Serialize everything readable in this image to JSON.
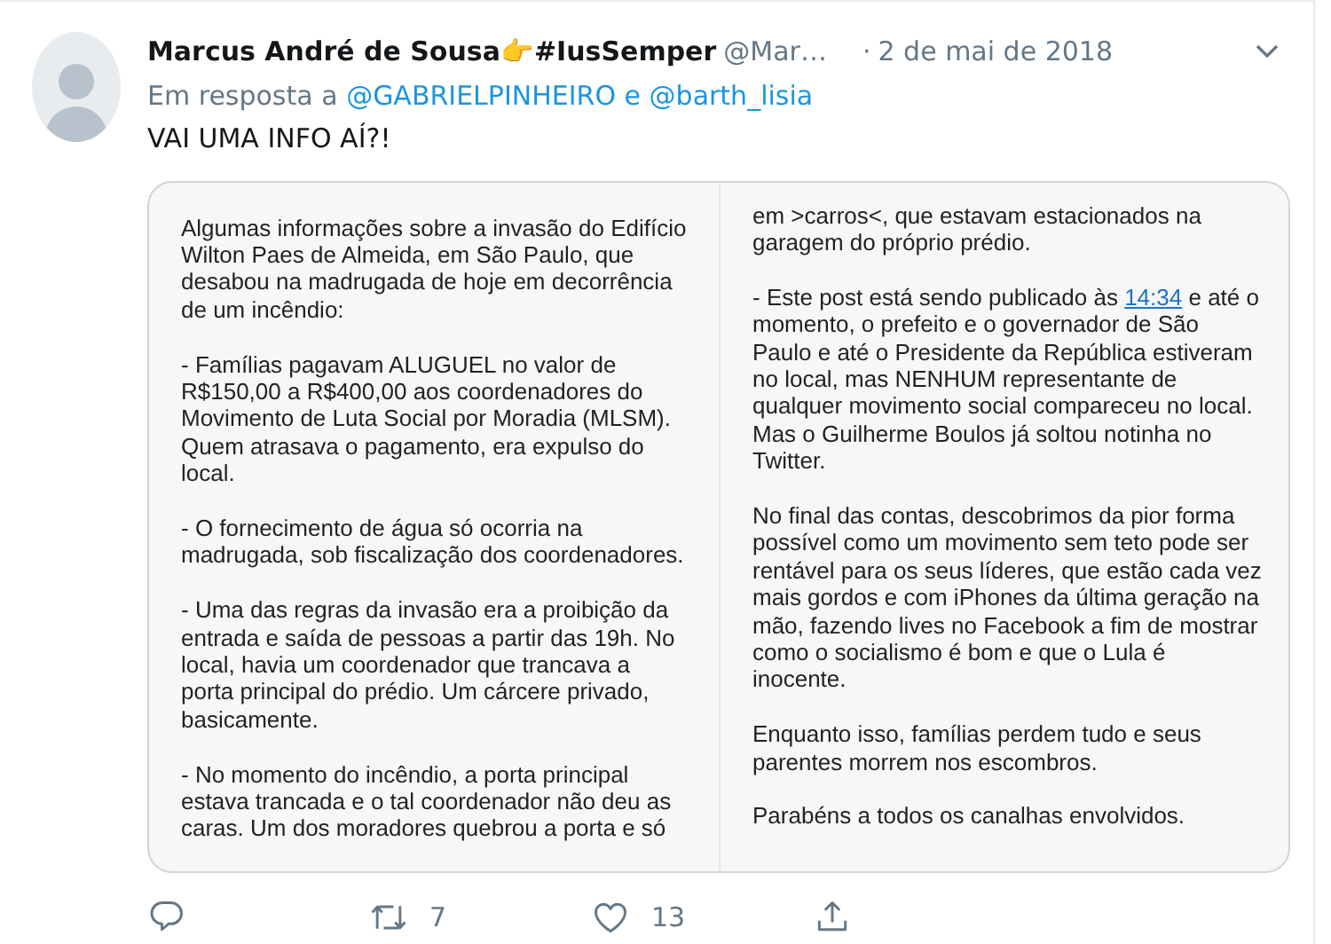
{
  "tweet": {
    "author": "Marcus André de Sousa👉#IusSemper",
    "handle": "@Mar…",
    "separator": "·",
    "date": "2 de mai de 2018",
    "reply_to": {
      "prefix": "Em resposta a",
      "mentions": [
        "@GABRIELPINHEIRO",
        "@barth_lisia"
      ],
      "joiner": "e"
    },
    "text": "VAI UMA INFO AÍ?!",
    "image_columns": [
      {
        "paragraphs": [
          [
            {
              "text": "Algumas informações sobre a invasão do Edifício\nWilton Paes de Almeida, em São Paulo, que\ndesabou na madrugada de hoje em decorrência\nde um incêndio:",
              "kind": "text"
            }
          ],
          [
            {
              "text": "- Famílias pagavam ALUGUEL no valor de\nR$150,00 a R$400,00 aos coordenadores do\nMovimento de Luta Social por Moradia (MLSM).\nQuem atrasava o pagamento, era expulso do\nlocal.",
              "kind": "text"
            }
          ],
          [
            {
              "text": "- O fornecimento de água só ocorria na\nmadrugada, sob fiscalização dos coordenadores.",
              "kind": "text"
            }
          ],
          [
            {
              "text": "- Uma das regras da invasão era a proibição da\nentrada e saída de pessoas a partir das 19h. No\nlocal, havia um coordenador que trancava a\nporta principal do prédio. Um cárcere privado,\nbasicamente.",
              "kind": "text"
            }
          ],
          [
            {
              "text": "- No momento do incêndio, a porta principal\nestava trancada e o tal coordenador não deu as\ncaras. Um dos moradores quebrou a porta e só",
              "kind": "text"
            }
          ]
        ]
      },
      {
        "paragraphs": [
          [
            {
              "text": "em >carros<, que estavam estacionados na\ngaragem do próprio prédio.",
              "kind": "text"
            }
          ],
          [
            {
              "text": "- Este post está sendo publicado às ",
              "kind": "text"
            },
            {
              "text": "14:34",
              "kind": "link"
            },
            {
              "text": " e até o\nmomento, o prefeito e o governador de São\nPaulo e até o Presidente da República estiveram\nno local, mas NENHUM representante de\nqualquer movimento social compareceu no local.\nMas o Guilherme Boulos já soltou notinha no\nTwitter.",
              "kind": "text"
            }
          ],
          [
            {
              "text": "No final das contas, descobrimos da pior forma\npossível como um movimento sem teto pode ser\nrentável para os seus líderes, que estão cada vez\nmais gordos e com iPhones da última geração na\nmão, fazendo lives no Facebook a fim de mostrar\ncomo o socialismo é bom e que o Lula é\ninocente.",
              "kind": "text"
            }
          ],
          [
            {
              "text": "Enquanto isso, famílias perdem tudo e seus\nparentes morrem nos escombros.",
              "kind": "text"
            }
          ],
          [
            {
              "text": "Parabéns a todos os canalhas envolvidos.",
              "kind": "text"
            }
          ]
        ]
      }
    ],
    "actions": [
      {
        "kind": "reply"
      },
      {
        "kind": "retweet",
        "count": "7"
      },
      {
        "kind": "like",
        "count": "13"
      },
      {
        "kind": "share"
      }
    ]
  }
}
